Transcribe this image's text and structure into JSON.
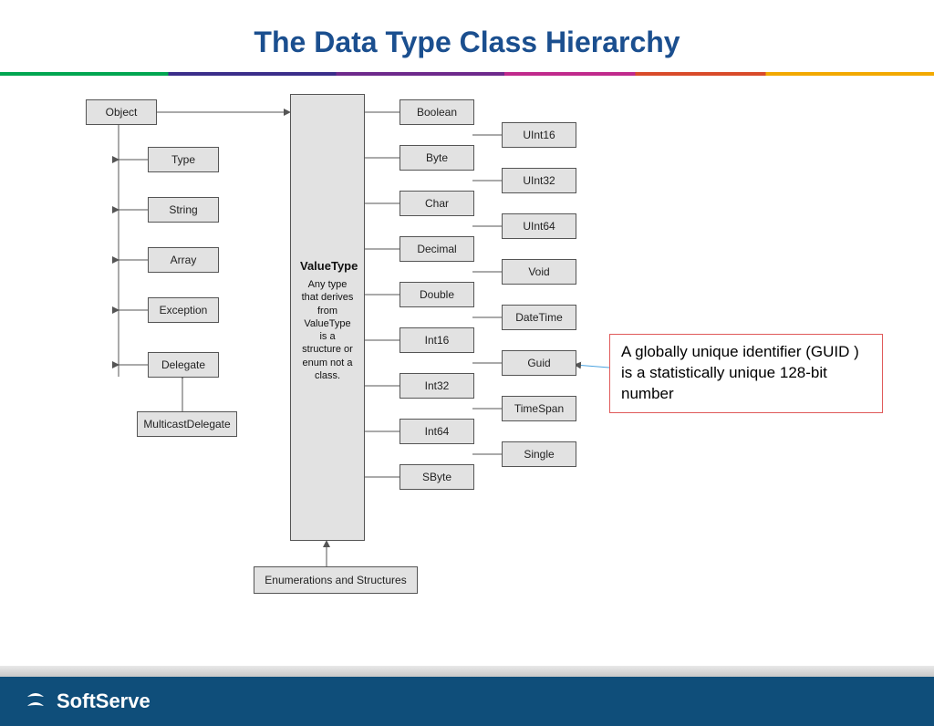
{
  "title": "The Data Type Class Hierarchy",
  "nodes": {
    "object": "Object",
    "type": "Type",
    "string": "String",
    "array": "Array",
    "exception": "Exception",
    "delegate": "Delegate",
    "multicast": "MulticastDelegate",
    "valuetype_title": "ValueType",
    "valuetype_desc": "Any type that derives from ValueType is a structure or enum not a class.",
    "enum_struct": "Enumerations and Structures",
    "left_col": [
      "Boolean",
      "Byte",
      "Char",
      "Decimal",
      "Double",
      "Int16",
      "Int32",
      "Int64",
      "SByte"
    ],
    "right_col": [
      "UInt16",
      "UInt32",
      "UInt64",
      "Void",
      "DateTime",
      "Guid",
      "TimeSpan",
      "Single"
    ]
  },
  "callout": "A globally unique identifier (GUID ) is a statistically unique 128-bit number",
  "brand": "SoftServe"
}
